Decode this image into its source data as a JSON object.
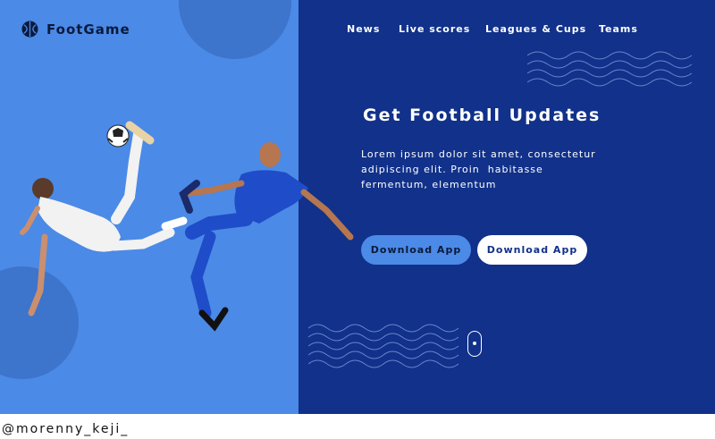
{
  "brand": {
    "name": "FootGame",
    "logo_icon": "soccer-ball-icon"
  },
  "nav": {
    "items": [
      {
        "label": "News"
      },
      {
        "label": "Live scores"
      },
      {
        "label": "Leagues & Cups"
      },
      {
        "label": "Teams"
      }
    ]
  },
  "hero": {
    "headline": "Get Football Updates",
    "description_lines": [
      "Lorem ipsum dolor sit amet, consectetur",
      "adipiscing elit. Proin  habitasse",
      "fermentum, elementum"
    ],
    "buttons": {
      "primary_label": "Download App",
      "secondary_label": "Download App"
    }
  },
  "footer": {
    "credit": "@morenny_keji_"
  },
  "colors": {
    "left_panel": "#4b8ae6",
    "right_panel": "#11318a",
    "accent_circle": "#3d74cc",
    "white": "#ffffff"
  }
}
